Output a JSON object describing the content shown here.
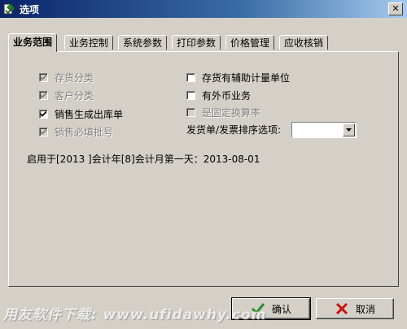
{
  "window": {
    "title": "选项",
    "close_label": "✕"
  },
  "tabs": [
    {
      "label": "业务范围",
      "active": true
    },
    {
      "label": "业务控制",
      "active": false
    },
    {
      "label": "系统参数",
      "active": false
    },
    {
      "label": "打印参数",
      "active": false
    },
    {
      "label": "价格管理",
      "active": false
    },
    {
      "label": "应收核销",
      "active": false
    }
  ],
  "options_left": [
    {
      "label": "存货分类",
      "checked": true,
      "disabled": true
    },
    {
      "label": "客户分类",
      "checked": true,
      "disabled": true
    },
    {
      "label": "销售生成出库单",
      "checked": true,
      "disabled": false
    },
    {
      "label": "销售必填批号",
      "checked": true,
      "disabled": true
    }
  ],
  "options_right": [
    {
      "label": "存货有辅助计量单位",
      "checked": false,
      "disabled": false
    },
    {
      "label": "有外币业务",
      "checked": false,
      "disabled": false
    },
    {
      "label": "是固定换算率",
      "checked": false,
      "disabled": true
    }
  ],
  "sort_option": {
    "label": "发货单/发票排序选项:",
    "value": ""
  },
  "enable_text": "启用于[2013 ]会计年[8]会计月第一天：2013-08-01",
  "buttons": {
    "ok_label": "确认",
    "cancel_label": "取消"
  },
  "watermark": "用友软件下载: www.ufidawhy.com",
  "colors": {
    "titlebar_start": "#0a246a",
    "titlebar_end": "#a6caf0",
    "face": "#d4d0c8",
    "ok_icon": "#2e8b2e",
    "cancel_icon": "#cc1111"
  }
}
